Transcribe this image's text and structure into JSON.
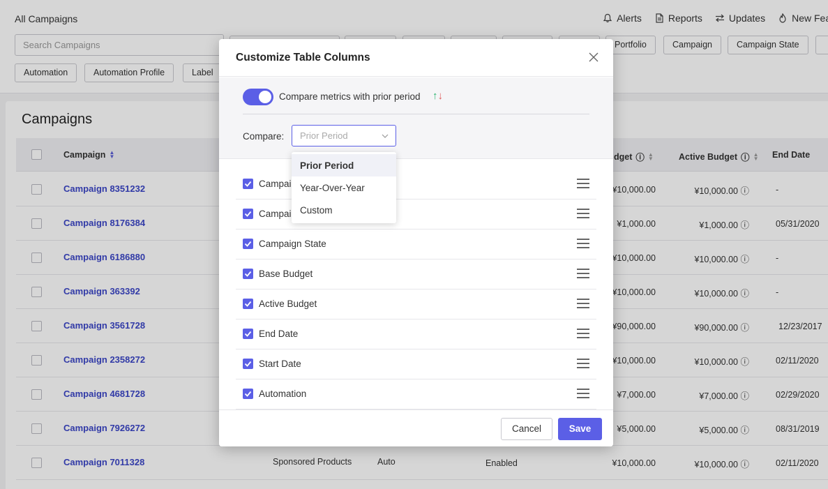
{
  "header": {
    "breadcrumb": "All Campaigns",
    "nav": [
      {
        "label": "Alerts",
        "icon": "bell-icon"
      },
      {
        "label": "Reports",
        "icon": "document-icon"
      },
      {
        "label": "Updates",
        "icon": "arrows-swap-icon"
      },
      {
        "label": "New Feat",
        "icon": "flame-icon"
      }
    ]
  },
  "filters": {
    "search_placeholder": "Search Campaigns",
    "chips_row1": [
      "Portfolio",
      "Campaign",
      "Campaign State"
    ],
    "chips_row2": [
      "Automation",
      "Automation Profile",
      "Label"
    ]
  },
  "table": {
    "title": "Campaigns",
    "columns": {
      "campaign": "Campaign",
      "budget": "dget",
      "active_budget": "Active Budget",
      "end_date": "End Date"
    },
    "rows": [
      {
        "name": "Campaign 8351232",
        "budget": "¥10,000.00",
        "active": "¥10,000.00",
        "end": "-"
      },
      {
        "name": "Campaign 8176384",
        "budget": "¥1,000.00",
        "active": "¥1,000.00",
        "end": "05/31/2020"
      },
      {
        "name": "Campaign 6186880",
        "budget": "¥10,000.00",
        "active": "¥10,000.00",
        "end": "-"
      },
      {
        "name": "Campaign 363392",
        "budget": "¥10,000.00",
        "active": "¥10,000.00",
        "end": "-"
      },
      {
        "name": "Campaign 3561728",
        "budget": "¥90,000.00",
        "active": "¥90,000.00",
        "end": "12/23/2017"
      },
      {
        "name": "Campaign 2358272",
        "budget": "¥10,000.00",
        "active": "¥10,000.00",
        "end": "02/11/2020"
      },
      {
        "name": "Campaign 4681728",
        "budget": "¥7,000.00",
        "active": "¥7,000.00",
        "end": "02/29/2020"
      },
      {
        "name": "Campaign 7926272",
        "budget": "¥5,000.00",
        "active": "¥5,000.00",
        "end": "08/31/2019"
      },
      {
        "name": "Campaign 7011328",
        "type": "Sponsored Products",
        "targeting": "Auto",
        "state": "Enabled",
        "budget": "¥10,000.00",
        "active": "¥10,000.00",
        "end": "02/11/2020"
      }
    ]
  },
  "modal": {
    "title": "Customize Table Columns",
    "compare_toggle_label": "Compare metrics with prior period",
    "compare_toggle_on": true,
    "compare_label": "Compare:",
    "compare_placeholder": "Prior Period",
    "dropdown_options": [
      "Prior Period",
      "Year-Over-Year",
      "Custom"
    ],
    "dropdown_selected": "Prior Period",
    "columns": [
      {
        "label": "Campaign",
        "checked": true
      },
      {
        "label": "Campaign",
        "checked": true
      },
      {
        "label": "Campaign State",
        "checked": true
      },
      {
        "label": "Base Budget",
        "checked": true
      },
      {
        "label": "Active Budget",
        "checked": true
      },
      {
        "label": "End Date",
        "checked": true
      },
      {
        "label": "Start Date",
        "checked": true
      },
      {
        "label": "Automation",
        "checked": true
      }
    ],
    "cancel_label": "Cancel",
    "save_label": "Save"
  },
  "colors": {
    "accent": "#5b5fe6",
    "link": "#3c47c8",
    "up_arrow": "#27b36b",
    "down_arrow": "#e05a5a"
  }
}
